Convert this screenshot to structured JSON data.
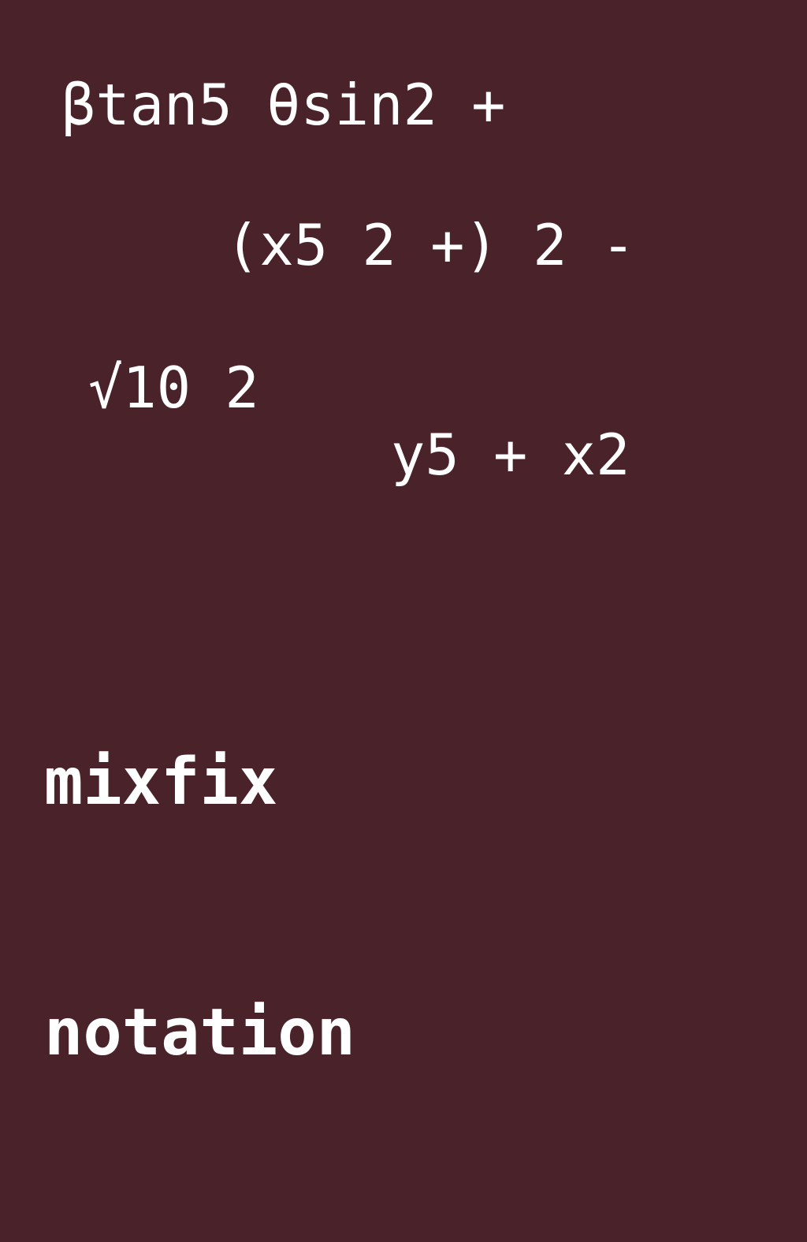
{
  "colors": {
    "background": "#4a232a",
    "text": "#ffffff"
  },
  "expressions": [
    "βtan5 θsin2 +",
    "(x5 2 +) 2 -",
    "√10 2",
    "y5 + x2"
  ],
  "title": {
    "line1": "mixfix",
    "line2": "notation"
  }
}
